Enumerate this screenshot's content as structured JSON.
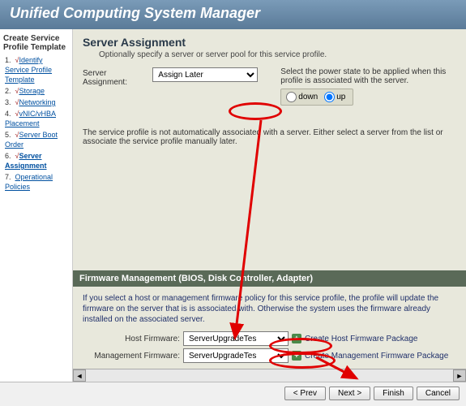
{
  "title": "Unified Computing System Manager",
  "left": {
    "heading": "Create Service Profile Template",
    "items": [
      {
        "num": "1.",
        "label": "Identify Service Profile Template",
        "checked": true
      },
      {
        "num": "2.",
        "label": "Storage",
        "checked": true
      },
      {
        "num": "3.",
        "label": "Networking",
        "checked": true
      },
      {
        "num": "4.",
        "label": "vNIC/vHBA Placement",
        "checked": true
      },
      {
        "num": "5.",
        "label": "Server Boot Order",
        "checked": true
      },
      {
        "num": "6.",
        "label": "Server Assignment",
        "checked": true,
        "current": true
      },
      {
        "num": "7.",
        "label": "Operational Policies",
        "checked": false
      }
    ]
  },
  "page": {
    "title": "Server Assignment",
    "subtitle": "Optionally specify a server or server pool for this service profile.",
    "assign_label": "Server Assignment:",
    "assign_value": "Assign Later",
    "power_text": "Select the power state to be applied when this profile is associated with the server.",
    "radio_down": "down",
    "radio_up": "up",
    "info": "The service profile is not automatically associated with a server. Either select a server from the list or associate the service profile manually later."
  },
  "firmware": {
    "bar": "Firmware Management (BIOS, Disk Controller, Adapter)",
    "desc": "If you select a host or management firmware policy for this service profile, the profile will update the firmware on the server that is is associated with. Otherwise the system uses the firmware already installed on the associated server.",
    "host_label": "Host Firmware:",
    "host_value": "ServerUpgradeTes",
    "host_link": "Create Host Firmware Package",
    "mgmt_label": "Management Firmware:",
    "mgmt_value": "ServerUpgradeTes",
    "mgmt_link": "Create Management Firmware Package"
  },
  "buttons": {
    "prev": "< Prev",
    "next": "Next >",
    "finish": "Finish",
    "cancel": "Cancel"
  }
}
